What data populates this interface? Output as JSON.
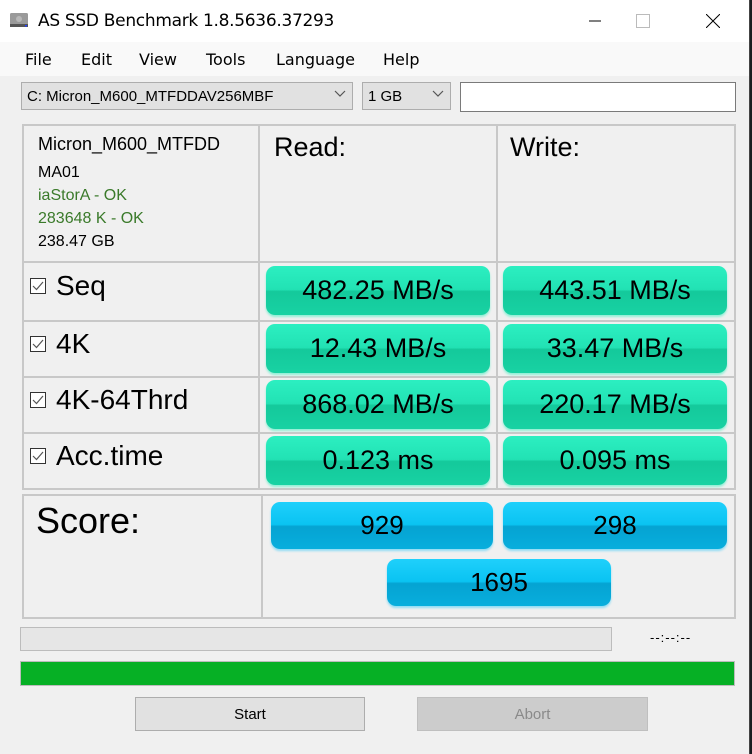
{
  "window": {
    "title": "AS SSD Benchmark 1.8.5636.37293",
    "icon": "ssd-drive-icon",
    "controls": {
      "minimize": "minimize-icon",
      "maximize": "maximize-icon",
      "close": "close-icon"
    }
  },
  "menu": [
    "File",
    "Edit",
    "View",
    "Tools",
    "Language",
    "Help"
  ],
  "toolbar": {
    "drive_select": "C: Micron_M600_MTFDDAV256MBF",
    "size_select": "1 GB",
    "text_input_value": ""
  },
  "drive_info": {
    "model": "Micron_M600_MTFDD",
    "firmware": "MA01",
    "driver_status": "iaStorA - OK",
    "alignment_status": "283648 K - OK",
    "capacity": "238.47 GB",
    "ok_color": "#3a7a2a"
  },
  "headers": {
    "read": "Read:",
    "write": "Write:"
  },
  "tests": [
    {
      "label": "Seq",
      "checked": true,
      "read": "482.25 MB/s",
      "write": "443.51 MB/s"
    },
    {
      "label": "4K",
      "checked": true,
      "read": "12.43 MB/s",
      "write": "33.47 MB/s"
    },
    {
      "label": "4K-64Thrd",
      "checked": true,
      "read": "868.02 MB/s",
      "write": "220.17 MB/s"
    },
    {
      "label": "Acc.time",
      "checked": true,
      "read": "0.123 ms",
      "write": "0.095 ms"
    }
  ],
  "score": {
    "label": "Score:",
    "read": "929",
    "write": "298",
    "total": "1695"
  },
  "status": {
    "timer": "--:--:--",
    "test_progress_percent": 0,
    "overall_progress_percent": 100,
    "progress_color": "#06b025"
  },
  "buttons": {
    "start": "Start",
    "abort": "Abort"
  },
  "colors": {
    "result_accent": "#22e2b4",
    "score_accent": "#0ac3f2"
  }
}
